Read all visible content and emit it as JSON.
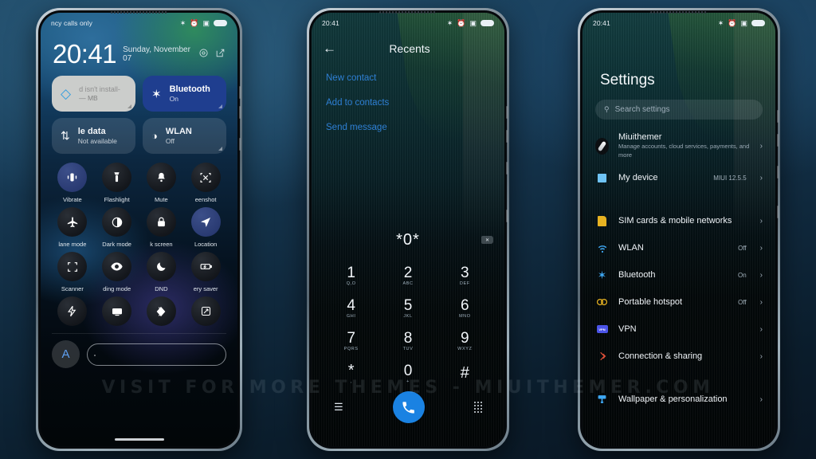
{
  "watermark": "VISIT FOR MORE THEMES - MIUITHEMER.COM",
  "phone_left": {
    "name": "control-center",
    "statusbar": {
      "carrier": "ncy calls only",
      "icons": [
        "bluetooth-icon",
        "alarm-icon",
        "screenshot-icon",
        "battery-icon"
      ]
    },
    "clock": "20:41",
    "date": "Sunday, November 07",
    "header_icons": [
      "settings-gear-icon",
      "edit-icon"
    ],
    "tiles": [
      {
        "title": "d isn't install-",
        "sub": "— MB",
        "state": "light",
        "icon": "water-drop-icon"
      },
      {
        "title": "Bluetooth",
        "sub": "On",
        "state": "on",
        "icon": "bluetooth-icon"
      },
      {
        "title": "le data",
        "sub": "Not available",
        "state": "dim",
        "icon": "mobile-data-icon"
      },
      {
        "title": "WLAN",
        "sub": "Off",
        "state": "dim",
        "icon": "wifi-icon"
      }
    ],
    "toggles": [
      {
        "label": "Vibrate",
        "icon": "vibrate-icon",
        "on": true
      },
      {
        "label": "Flashlight",
        "icon": "flashlight-icon",
        "on": false
      },
      {
        "label": "Mute",
        "icon": "bell-icon",
        "on": false
      },
      {
        "label": "eenshot",
        "icon": "screenshot-icon",
        "on": false
      },
      {
        "label": "lane mode",
        "icon": "airplane-icon",
        "on": false
      },
      {
        "label": "Dark mode",
        "icon": "contrast-icon",
        "on": false
      },
      {
        "label": "k screen",
        "icon": "lock-icon",
        "on": false
      },
      {
        "label": "Location",
        "icon": "location-icon",
        "on": true
      },
      {
        "label": "Scanner",
        "icon": "scan-frame-icon",
        "on": false
      },
      {
        "label": "ding mode",
        "icon": "eye-icon",
        "on": false
      },
      {
        "label": "DND",
        "icon": "moon-icon",
        "on": false
      },
      {
        "label": "ery saver",
        "icon": "battery-saver-icon",
        "on": false
      }
    ],
    "toggles_last_row": [
      {
        "label": "",
        "icon": "lightning-icon"
      },
      {
        "label": "",
        "icon": "cast-screen-icon"
      },
      {
        "label": "",
        "icon": "video-toolbox-icon"
      },
      {
        "label": "",
        "icon": "screen-rotate-icon"
      }
    ],
    "brightness": {
      "auto_label": "A",
      "icon": "auto-brightness-icon"
    }
  },
  "phone_mid": {
    "name": "dialer",
    "statusbar": {
      "time": "20:41",
      "icons": [
        "bluetooth-icon",
        "alarm-icon",
        "screenshot-icon",
        "battery-icon"
      ]
    },
    "title": "Recents",
    "back_icon": "back-arrow-icon",
    "links": [
      "New contact",
      "Add to contacts",
      "Send message"
    ],
    "dial_value": "*0*",
    "backspace_icon": "backspace-icon",
    "keys": [
      {
        "digit": "1",
        "letters": "Q,O"
      },
      {
        "digit": "2",
        "letters": "ABC"
      },
      {
        "digit": "3",
        "letters": "DEF"
      },
      {
        "digit": "4",
        "letters": "GHI"
      },
      {
        "digit": "5",
        "letters": "JKL"
      },
      {
        "digit": "6",
        "letters": "MNO"
      },
      {
        "digit": "7",
        "letters": "PQRS"
      },
      {
        "digit": "8",
        "letters": "TUV"
      },
      {
        "digit": "9",
        "letters": "WXYZ"
      },
      {
        "digit": "*",
        "letters": ","
      },
      {
        "digit": "0",
        "letters": "+"
      },
      {
        "digit": "#",
        "letters": ""
      }
    ],
    "bottom": {
      "menu_icon": "hamburger-menu-icon",
      "call_icon": "phone-call-icon",
      "keypad_icon": "keypad-dots-icon"
    }
  },
  "phone_right": {
    "name": "settings",
    "statusbar": {
      "time": "20:41",
      "icons": [
        "bluetooth-icon",
        "alarm-icon",
        "screenshot-icon",
        "battery-icon"
      ]
    },
    "title": "Settings",
    "search_placeholder": "Search settings",
    "search_icon": "search-icon",
    "account": {
      "label": "Miuithemer",
      "sub": "Manage accounts, cloud services, payments, and more",
      "icon": "account-avatar-icon"
    },
    "items": [
      {
        "label": "My device",
        "value": "MIUI 12.5.5",
        "icon": "device-icon"
      },
      {
        "label": "SIM cards & mobile networks",
        "value": "",
        "icon": "sim-card-icon"
      },
      {
        "label": "WLAN",
        "value": "Off",
        "icon": "wifi-icon"
      },
      {
        "label": "Bluetooth",
        "value": "On",
        "icon": "bluetooth-icon"
      },
      {
        "label": "Portable hotspot",
        "value": "Off",
        "icon": "hotspot-icon"
      },
      {
        "label": "VPN",
        "value": "",
        "icon": "vpn-icon"
      },
      {
        "label": "Connection & sharing",
        "value": "",
        "icon": "connection-sharing-icon"
      },
      {
        "label": "Wallpaper & personalization",
        "value": "",
        "icon": "wallpaper-icon"
      }
    ],
    "chevron_icon": "chevron-right-icon"
  },
  "colors": {
    "accent_blue": "#1a82e2",
    "tile_blue": "#1f3e8f",
    "link_blue": "#2e7fd4",
    "bg": "#10293d"
  }
}
